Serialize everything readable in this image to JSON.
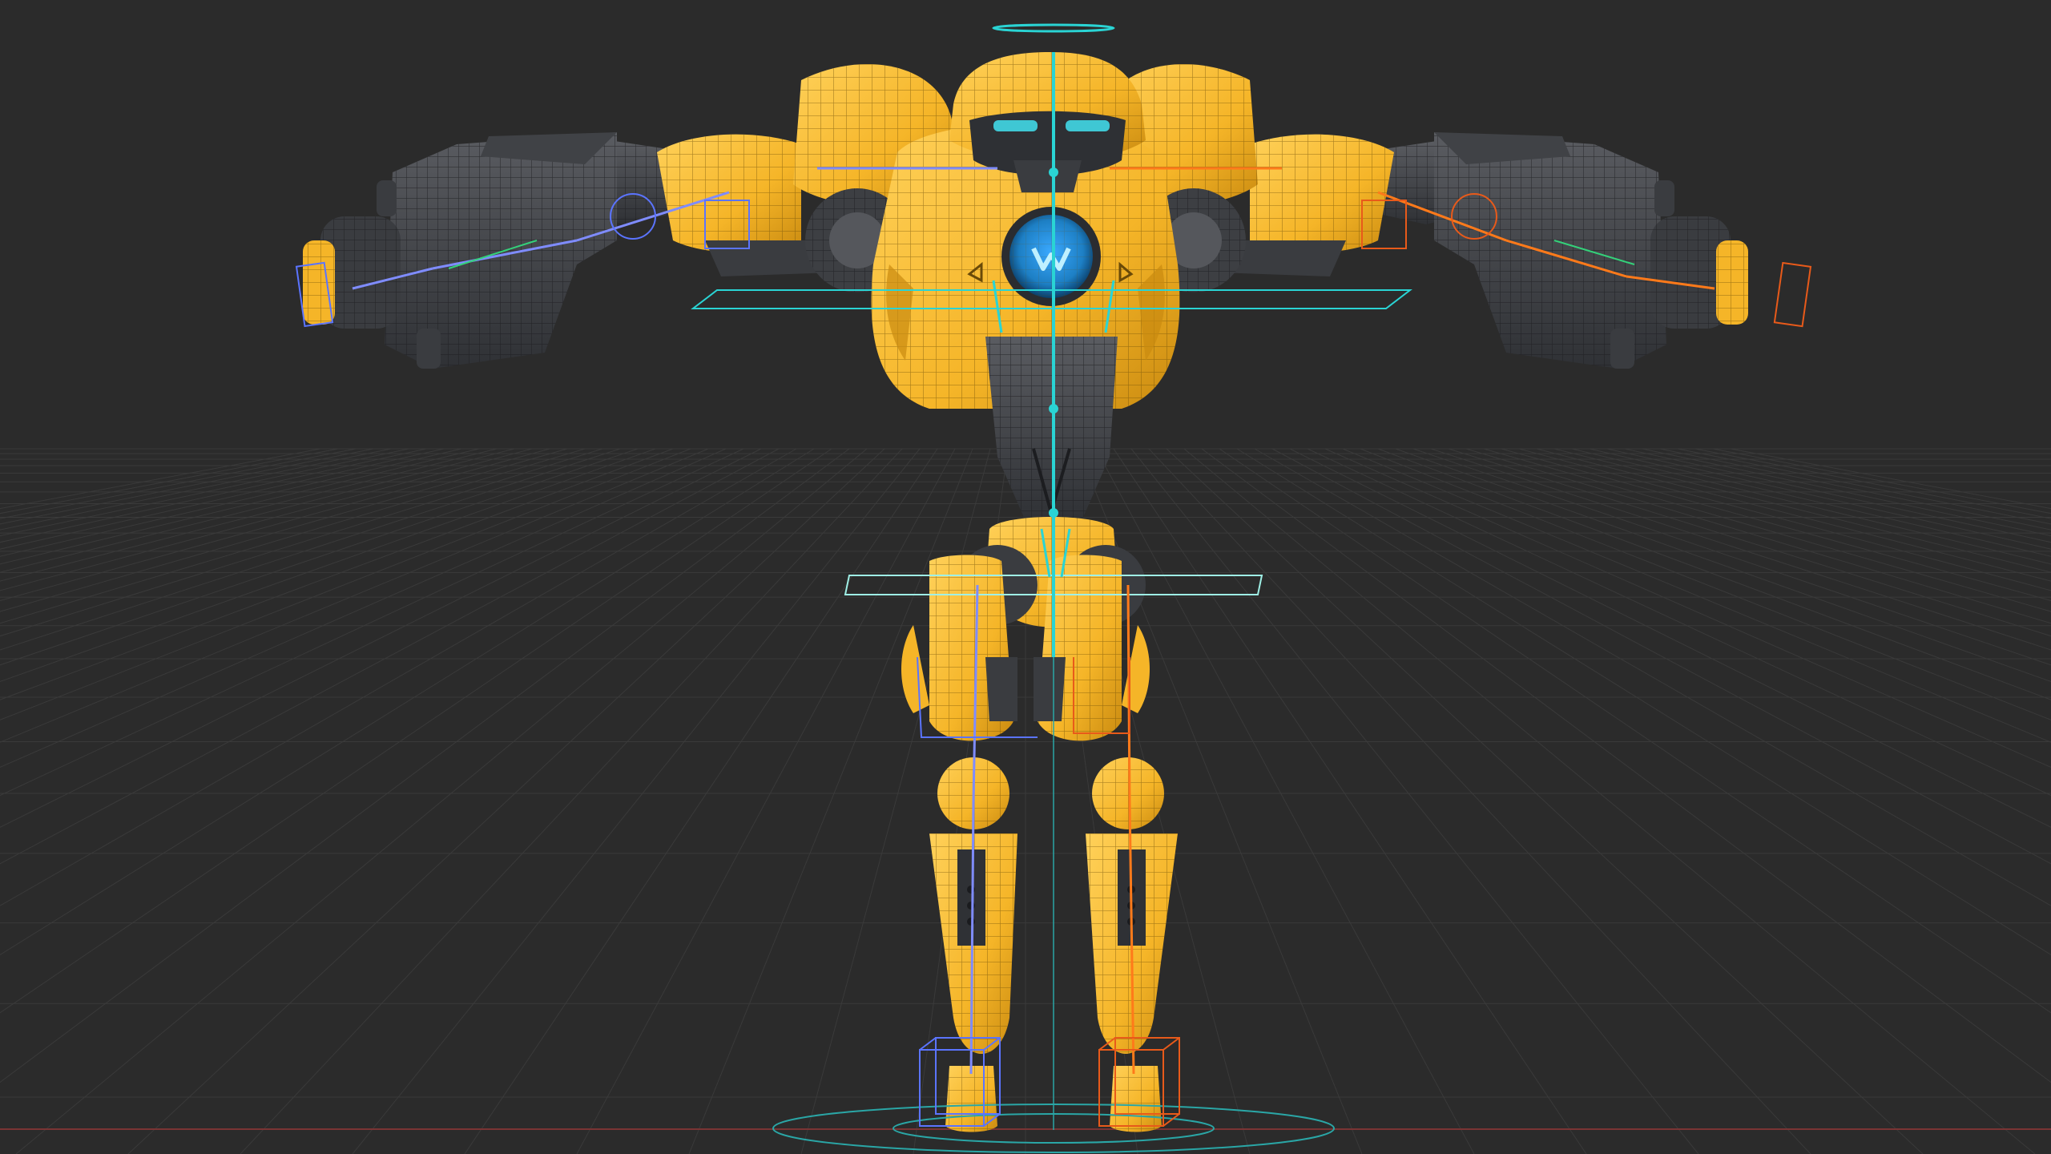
{
  "viewport": {
    "colors": {
      "background": "#2b2b2b",
      "grid": "#3a3a3a",
      "x_axis": "#7a3434",
      "z_axis": "#6a8a3a"
    },
    "grid_visible": true
  },
  "model": {
    "colors": {
      "armor": "#f5b528",
      "armor_dark": "#c98a10",
      "wire": "#6a4a08",
      "metal": "#4a4c50",
      "metal_dark": "#2f3135",
      "chest_core": "#1d7fc4",
      "eyes": "#3fc7d4"
    },
    "parts": [
      "head",
      "torso",
      "chest-core",
      "left-shoulder",
      "right-shoulder",
      "left-arm-cannon",
      "right-arm-cannon",
      "abdomen",
      "pelvis",
      "left-leg",
      "right-leg",
      "left-foot",
      "right-foot"
    ]
  },
  "rig": {
    "colors": {
      "center": "#2ad4d4",
      "left": "#7f8cff",
      "right": "#ff7a1a",
      "ik_left": "#5b74ff",
      "ik_right": "#e85a1a",
      "root": "#2aa6a6",
      "wrist": "#34d17a"
    },
    "controls": [
      "head-halo",
      "chest-plane",
      "hip-plane",
      "root-circle",
      "left-foot-ik-box",
      "right-foot-ik-box",
      "left-hand-box",
      "right-hand-box"
    ]
  }
}
